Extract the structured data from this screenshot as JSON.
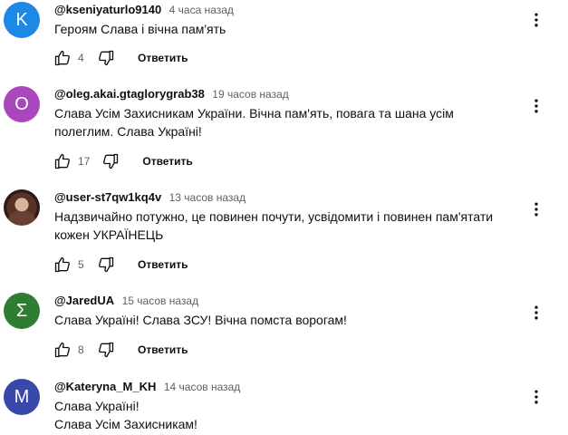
{
  "comments": [
    {
      "avatar_letter": "K",
      "avatar_color": "#1e88e5",
      "author": "@kseniyaturlo9140",
      "time": "4 часа назад",
      "text": "Героям Слава і вічна пам'ять",
      "likes": "4",
      "reply": "Ответить"
    },
    {
      "avatar_letter": "O",
      "avatar_color": "#ab47bc",
      "author": "@oleg.akai.gtaglorygrab38",
      "time": "19 часов назад",
      "text": "Слава Усім Захисникам України. Вічна пам'ять, повага та шана усім полеглим. Слава Україні!",
      "likes": "17",
      "reply": "Ответить"
    },
    {
      "avatar_letter": "",
      "avatar_color": "#5b3127",
      "author": "@user-st7qw1kq4v",
      "time": "13 часов назад",
      "text": "Надзвичайно потужно,   це повинен почути,  усвідомити і повинен пам'ятати кожен УКРАЇНЕЦЬ",
      "likes": "5",
      "reply": "Ответить"
    },
    {
      "avatar_letter": "Σ",
      "avatar_color": "#2e7d32",
      "author": "@JaredUA",
      "time": "15 часов назад",
      "text": "Слава Україні! Слава ЗСУ! Вічна помста ворогам!",
      "likes": "8",
      "reply": "Ответить"
    },
    {
      "avatar_letter": "M",
      "avatar_color": "#3949ab",
      "author": "@Kateryna_M_KH",
      "time": "14 часов назад",
      "text": "Слава Україні!\nСлава Усім Захисникам!",
      "likes": "",
      "reply": ""
    }
  ],
  "icons": {
    "like": "thumb-up-outline-icon",
    "dislike": "thumb-down-outline-icon",
    "menu": "more-vert-icon"
  }
}
